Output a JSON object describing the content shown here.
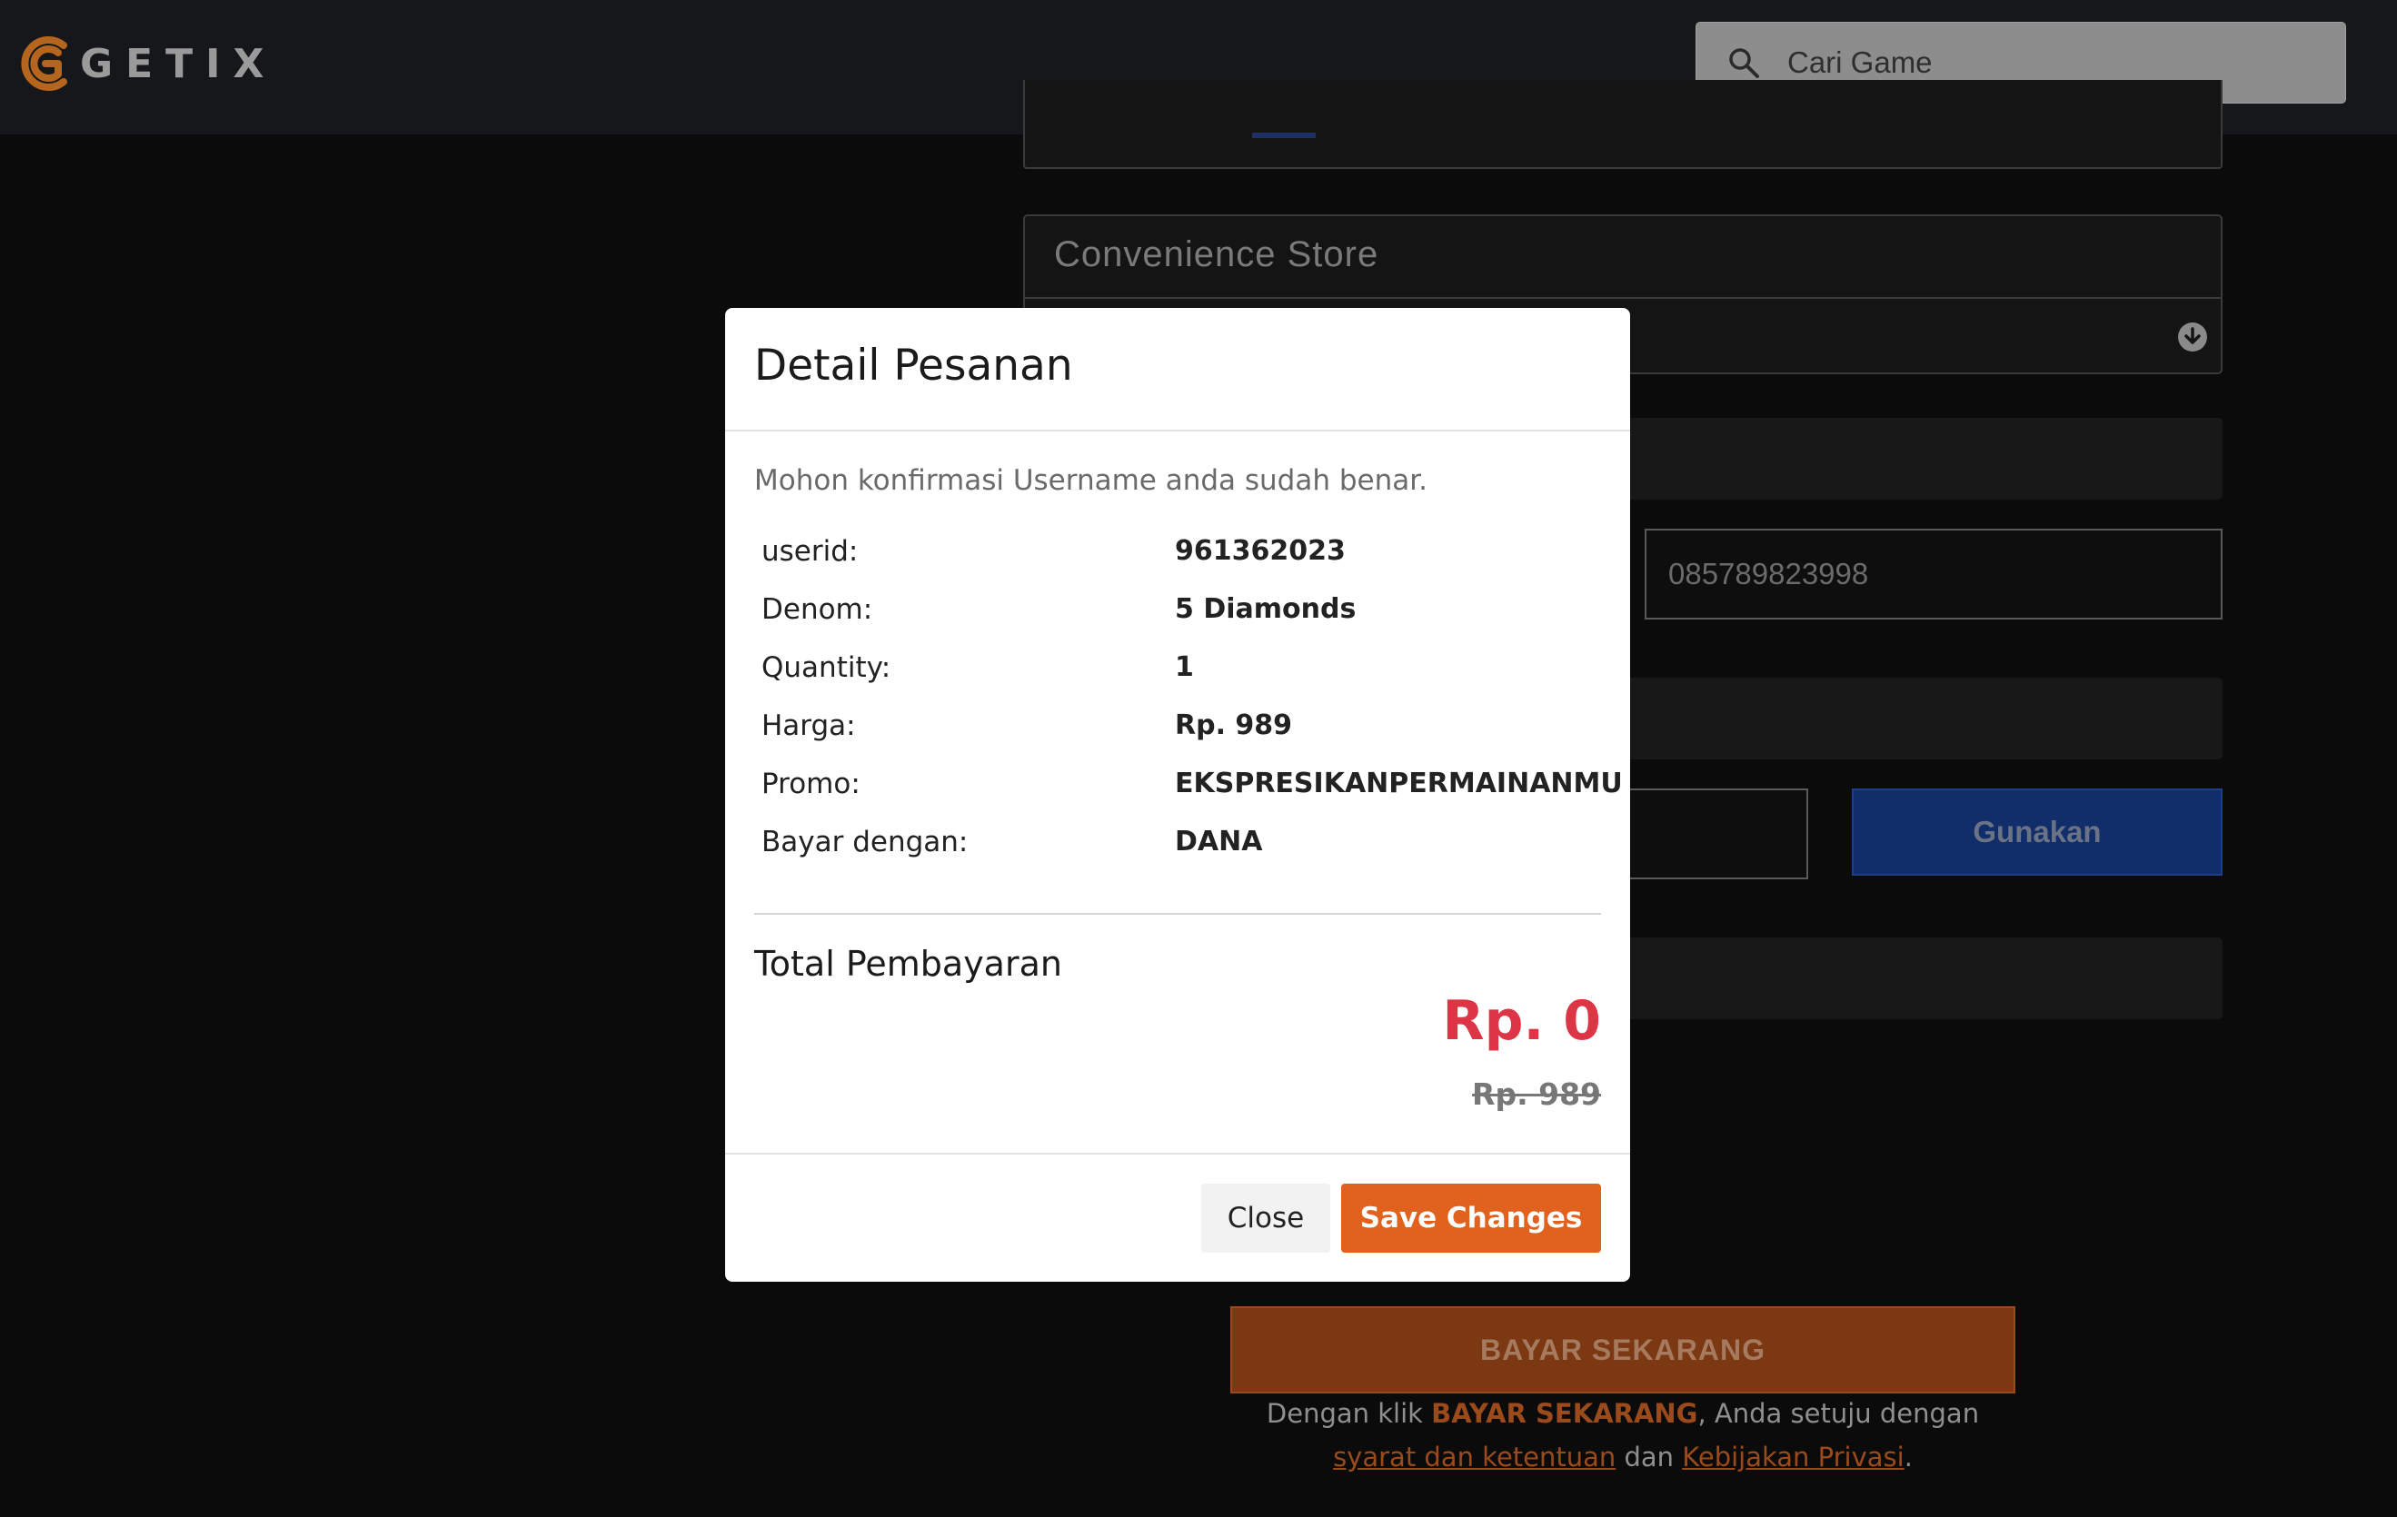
{
  "header": {
    "logo_text": "GETIX",
    "search": {
      "placeholder": "Cari Game"
    }
  },
  "background_form": {
    "store_title": "Convenience Store",
    "phone_value": "085789823998",
    "apply_label": "Gunakan",
    "pay_label": "BAYAR SEKARANG",
    "terms": {
      "prefix": "Dengan klik ",
      "emphasis": "BAYAR SEKARANG",
      "middle": ", Anda setuju dengan ",
      "link_terms": "syarat dan ketentuan",
      "and": " dan ",
      "link_privacy": "Kebijakan Privasi",
      "suffix": "."
    }
  },
  "modal": {
    "title": "Detail Pesanan",
    "note": "Mohon konfirmasi Username anda sudah benar.",
    "rows": [
      {
        "label": "userid:",
        "value": "961362023"
      },
      {
        "label": "Denom:",
        "value": "5 Diamonds"
      },
      {
        "label": "Quantity:",
        "value": "1"
      },
      {
        "label": "Harga:",
        "value": "Rp. 989"
      },
      {
        "label": "Promo:",
        "value": "EKSPRESIKANPERMAINANMU"
      },
      {
        "label": "Bayar dengan:",
        "value": "DANA"
      }
    ],
    "total_title": "Total Pembayaran",
    "total_value": "Rp. 0",
    "total_original": "Rp. 989",
    "close_label": "Close",
    "save_label": "Save Changes"
  },
  "colors": {
    "accent_orange": "#e0621e",
    "total_red": "#dc3545",
    "apply_blue": "#112e6a"
  }
}
